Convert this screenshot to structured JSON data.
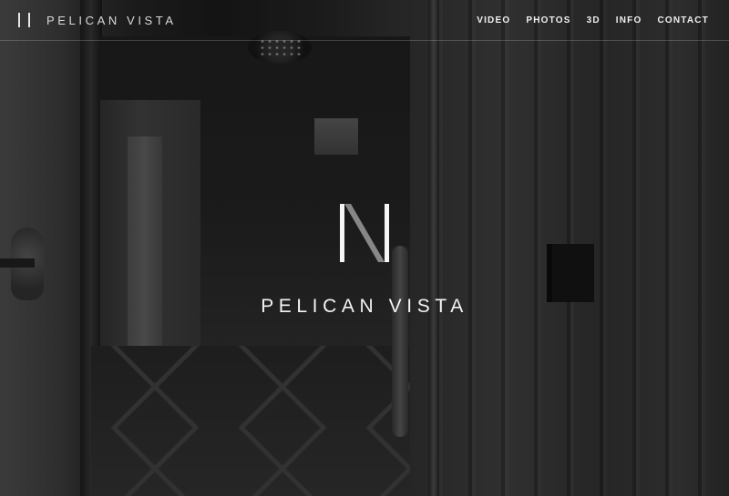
{
  "brand": {
    "name": "PELICAN VISTA",
    "logo_icon": "pelican-vista-logo-icon"
  },
  "nav": {
    "items": [
      {
        "label": "VIDEO"
      },
      {
        "label": "PHOTOS"
      },
      {
        "label": "3D"
      },
      {
        "label": "INFO"
      },
      {
        "label": "CONTACT"
      }
    ]
  },
  "hero": {
    "title": "PELICAN VISTA",
    "logo_icon": "pelican-vista-monogram-icon"
  },
  "colors": {
    "text": "#f0f0f0",
    "overlay": "#000000"
  }
}
